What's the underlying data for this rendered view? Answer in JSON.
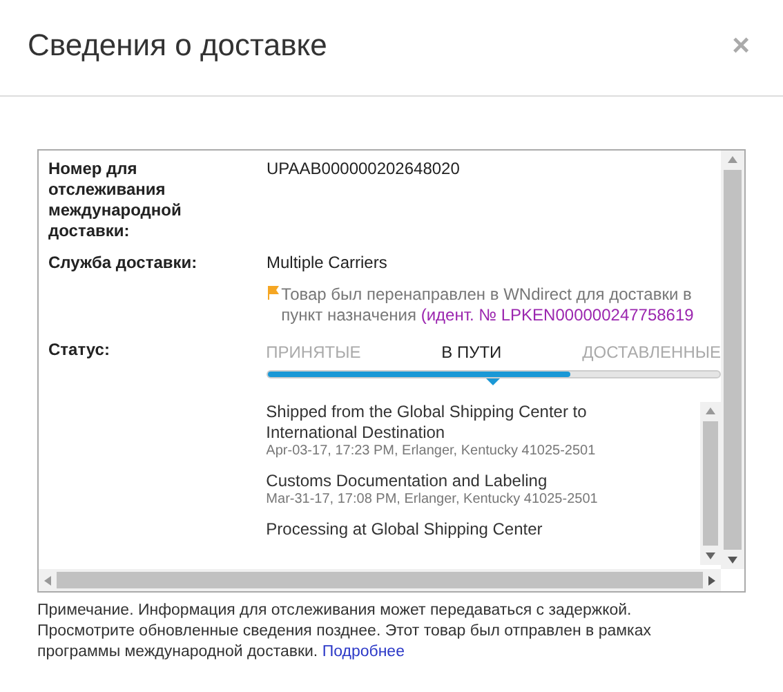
{
  "dialog": {
    "title": "Сведения о доставке",
    "close": "×"
  },
  "fields": [
    {
      "label": "Номер для отслеживания международной доставки:",
      "value": "UPAAB000000202648020"
    },
    {
      "label": "Служба доставки:",
      "value": "Multiple Carriers"
    }
  ],
  "notice": {
    "text": "Товар был перенаправлен в WNdirect для доставки в пункт назначения",
    "link": "(идент. № LPKEN000000247758619"
  },
  "status": {
    "label": "Статус:",
    "steps": [
      {
        "label": "ПРИНЯТЫЕ",
        "selected": false
      },
      {
        "label": "В ПУТИ",
        "selected": true
      },
      {
        "label": "ДОСТАВЛЕННЫЕ",
        "selected": false
      }
    ],
    "level": 0.67,
    "events": [
      {
        "title": "Shipped from the Global Shipping Center to International Destination",
        "detail": "Apr-03-17, 17:23 PM, Erlanger, Kentucky 41025-2501"
      },
      {
        "title": "Customs Documentation and Labeling",
        "detail": "Mar-31-17, 17:08 PM, Erlanger, Kentucky 41025-2501"
      },
      {
        "title": "Processing at Global Shipping Center"
      }
    ]
  },
  "note": {
    "text": "Примечание. Информация для отслеживания может передаваться с задержкой. Просмотрите обновленные сведения позднее. Этот товар был отправлен в рамках программы международной доставки.",
    "link": "Подробнее"
  }
}
